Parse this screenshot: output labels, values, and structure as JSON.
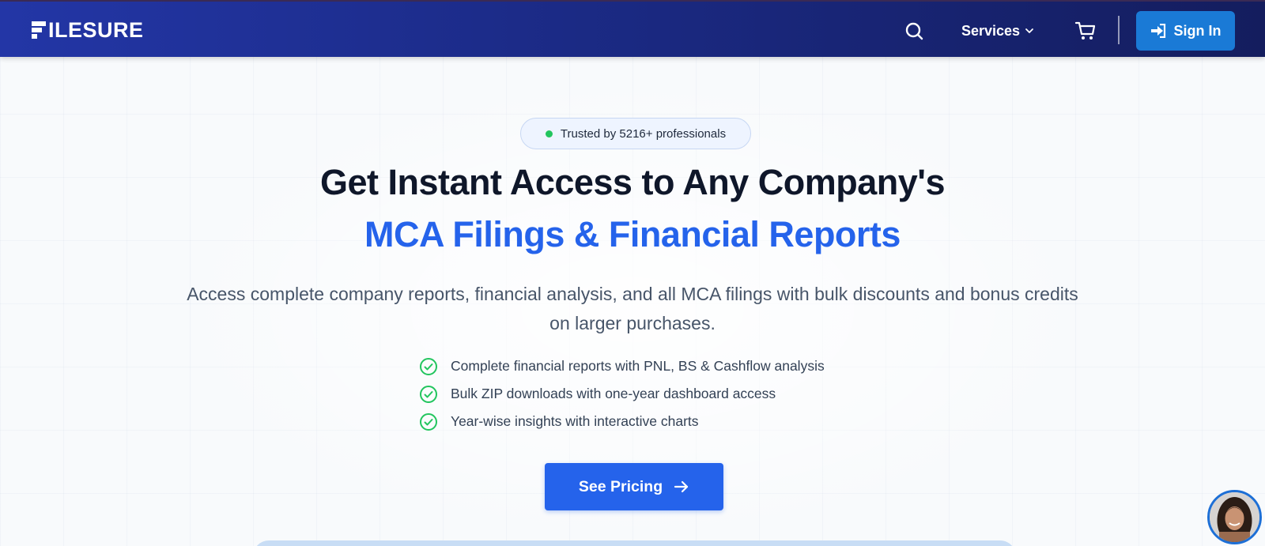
{
  "nav": {
    "logo_text": "ILESURE",
    "services_label": "Services",
    "signin_label": "Sign In",
    "colors": {
      "bar_start": "#2336a6",
      "bar_end": "#141d5e",
      "signin_bg": "#1a7ad6"
    }
  },
  "hero": {
    "trust_badge": "Trusted by 5216+ professionals",
    "headline_line1": "Get Instant Access to Any Company's",
    "headline_line2": "MCA Filings & Financial Reports",
    "subtitle": "Access complete company reports, financial analysis, and all MCA filings with bulk discounts and bonus credits on larger purchases.",
    "features": [
      "Complete financial reports with PNL, BS & Cashflow analysis",
      "Bulk ZIP downloads with one-year dashboard access",
      "Year-wise insights with interactive charts"
    ],
    "cta_label": "See Pricing",
    "colors": {
      "headline": "#0f172a",
      "accent": "#2563eb",
      "check": "#22c55e"
    }
  },
  "icons": {
    "search": "search-icon",
    "services_dropdown": "chevron-down-icon",
    "cart": "cart-icon",
    "signin": "sign-in-icon",
    "feature_check": "check-circle-icon",
    "cta_arrow": "arrow-right-icon",
    "chat": "chat-avatar"
  }
}
